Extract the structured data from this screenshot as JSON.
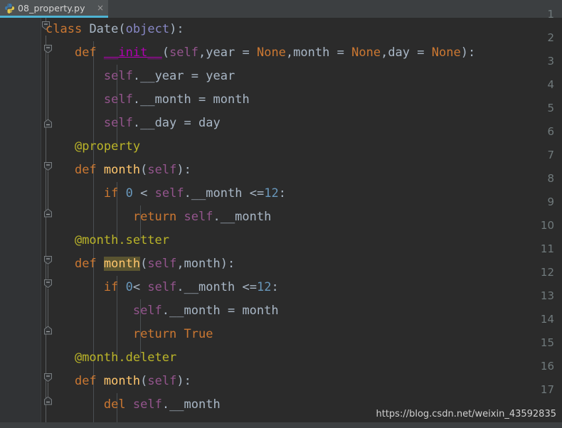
{
  "window": {
    "theme_name": "darcula",
    "colors": {
      "editor_background": "#2b2b2b",
      "gutter_background": "#313335",
      "tabbar_background": "#3c3f41",
      "tab_active_background": "#4e5254",
      "tab_active_underline": "#4eb3d3",
      "default_text": "#a9b7c6",
      "keyword": "#cc7832",
      "number": "#6897bb",
      "decorator": "#bbb529",
      "function_name": "#ffc66d",
      "self_param": "#94558d",
      "builtin": "#8888c6",
      "magic_method": "#b200b2",
      "identifier_highlight": "#5a5430",
      "line_number": "#707a7c"
    }
  },
  "tab": {
    "title": "08_property.py",
    "icon": "python-file-icon",
    "close_label": "×",
    "active": true
  },
  "editor": {
    "line_numbers": [
      "1",
      "2",
      "3",
      "4",
      "5",
      "6",
      "7",
      "8",
      "9",
      "10",
      "11",
      "12",
      "13",
      "14",
      "15",
      "16",
      "17"
    ],
    "lines": [
      {
        "n": "1",
        "text": "class Date(object):"
      },
      {
        "n": "2",
        "text": "    def __init__(self,year = None,month = None,day = None):"
      },
      {
        "n": "3",
        "text": "        self.__year = year"
      },
      {
        "n": "4",
        "text": "        self.__month = month"
      },
      {
        "n": "5",
        "text": "        self.__day = day"
      },
      {
        "n": "6",
        "text": "    @property"
      },
      {
        "n": "7",
        "text": "    def month(self):"
      },
      {
        "n": "8",
        "text": "        if 0 < self.__month <=12:"
      },
      {
        "n": "9",
        "text": "            return self.__month"
      },
      {
        "n": "10",
        "text": "    @month.setter"
      },
      {
        "n": "11",
        "text": "    def month(self,month):"
      },
      {
        "n": "12",
        "text": "        if 0< self.__month <=12:"
      },
      {
        "n": "13",
        "text": "            self.__month = month"
      },
      {
        "n": "14",
        "text": "            return True"
      },
      {
        "n": "15",
        "text": "    @month.deleter"
      },
      {
        "n": "16",
        "text": "    def month(self):"
      },
      {
        "n": "17",
        "text": "        del self.__month"
      }
    ],
    "tokens": {
      "kw_class": "class",
      "kw_def": "def",
      "kw_if": "if",
      "kw_return": "return",
      "kw_del": "del",
      "name_date": "Date",
      "name_object": "object",
      "name_init": "__init__",
      "name_self": "self",
      "name_month": "month",
      "name_year": "year",
      "name_day": "day",
      "name_priv_year": "__year",
      "name_priv_month": "__month",
      "name_priv_day": "__day",
      "const_none": "None",
      "const_true": "True",
      "num_zero": "0",
      "num_twelve": "12",
      "deco_property": "@property",
      "deco_month_setter": "@month.setter",
      "deco_month_deleter": "@month.deleter",
      "op_lt": "<",
      "op_lte": "<=",
      "op_assign": "=",
      "punc_colon": ":",
      "punc_comma": ",",
      "punc_lparen": "(",
      "punc_rparen": ")",
      "punc_dot": ".",
      "sp": " "
    },
    "highlighted_identifier": "month",
    "fold_markers": [
      {
        "line": "1",
        "type": "fold-collapse-start"
      },
      {
        "line": "2",
        "type": "fold-collapse-start"
      },
      {
        "line": "5",
        "type": "fold-region-end"
      },
      {
        "line": "7",
        "type": "fold-collapse-start"
      },
      {
        "line": "9",
        "type": "fold-region-end"
      },
      {
        "line": "11",
        "type": "fold-collapse-start"
      },
      {
        "line": "12",
        "type": "fold-collapse-start"
      },
      {
        "line": "14",
        "type": "fold-region-end"
      },
      {
        "line": "16",
        "type": "fold-collapse-start"
      },
      {
        "line": "17",
        "type": "fold-region-end"
      }
    ]
  },
  "watermark": {
    "text": "https://blog.csdn.net/weixin_43592835"
  }
}
